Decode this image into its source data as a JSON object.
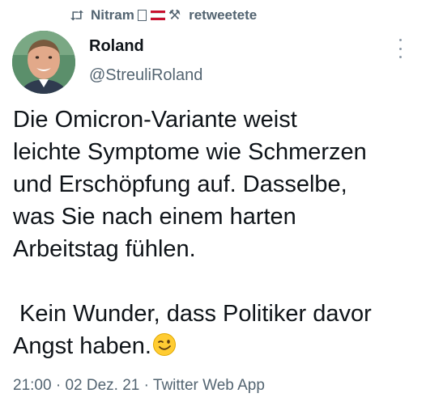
{
  "retweet": {
    "icon": "retweet-icon",
    "user": "Nitram",
    "suffix": "retweetete",
    "flag_colors": [
      "#c8102e",
      "#ffffff",
      "#c8102e"
    ]
  },
  "author": {
    "display_name": "Roland",
    "handle": "@StreuliRoland",
    "avatar": "profile-photo"
  },
  "tweet": {
    "lines": [
      "Die Omicron-Variante weist",
      "leichte Symptome wie Schmerzen",
      "und Erschöpfung auf. Dasselbe,",
      "was Sie nach einem harten",
      "Arbeitstag fühlen."
    ],
    "lines2": [
      " Kein Wunder, dass Politiker davor",
      "Angst haben."
    ],
    "emoji": "winking-face-emoji"
  },
  "meta": {
    "time": "21:00",
    "date": "02 Dez. 21",
    "separator": "·",
    "source": "Twitter Web App"
  },
  "colors": {
    "text": "#0f1419",
    "secondary": "#536471"
  }
}
